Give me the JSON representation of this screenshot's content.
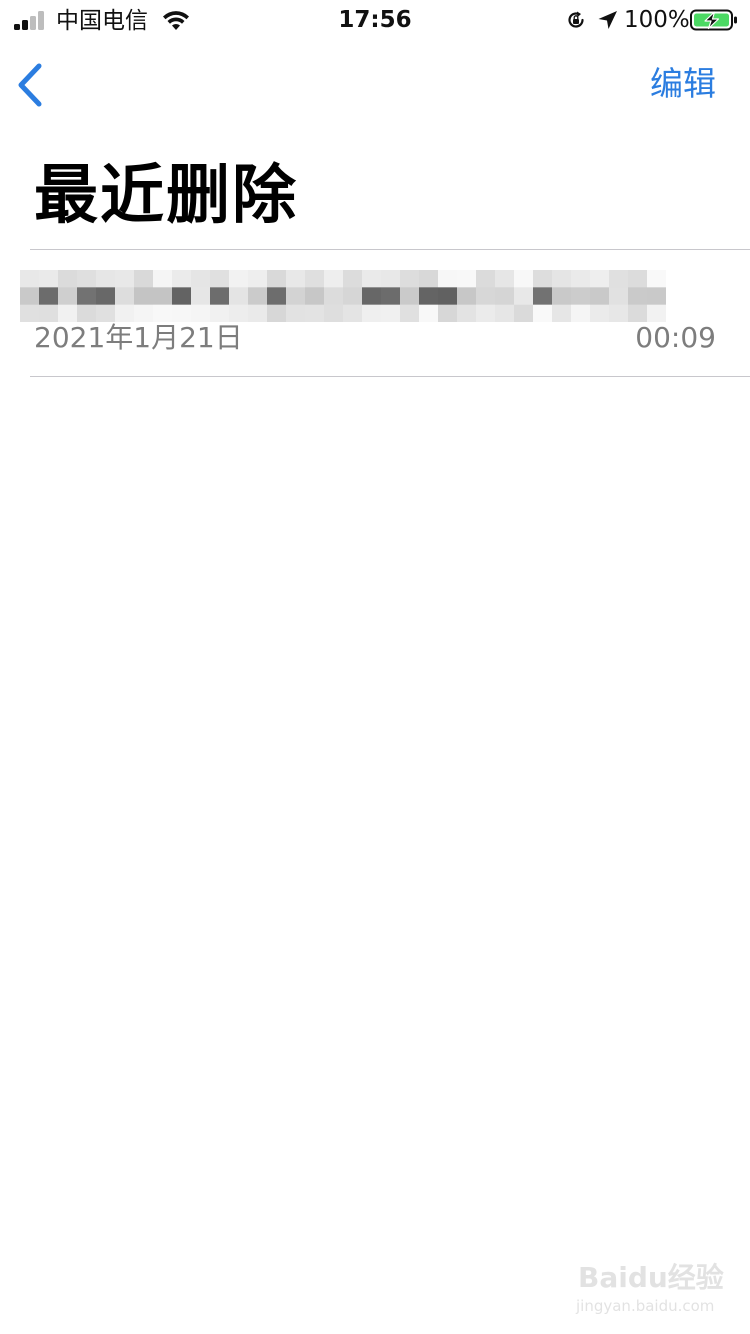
{
  "status_bar": {
    "carrier": "中国电信",
    "time": "17:56",
    "battery_percent": "100%",
    "signal_icon": "cellular-signal-icon",
    "wifi_icon": "wifi-icon",
    "rotation_lock_icon": "rotation-lock-icon",
    "location_icon": "location-arrow-icon",
    "battery_icon": "battery-charging-icon",
    "battery_color": "#4cd964"
  },
  "nav": {
    "back_icon": "chevron-left-icon",
    "edit_label": "编辑",
    "accent_color": "#2b7de0"
  },
  "page": {
    "title": "最近删除"
  },
  "notes": [
    {
      "date": "2021年1月21日",
      "time": "00:09"
    }
  ],
  "watermark": {
    "logo": "Baidu经验",
    "url": "jingyan.baidu.com"
  }
}
